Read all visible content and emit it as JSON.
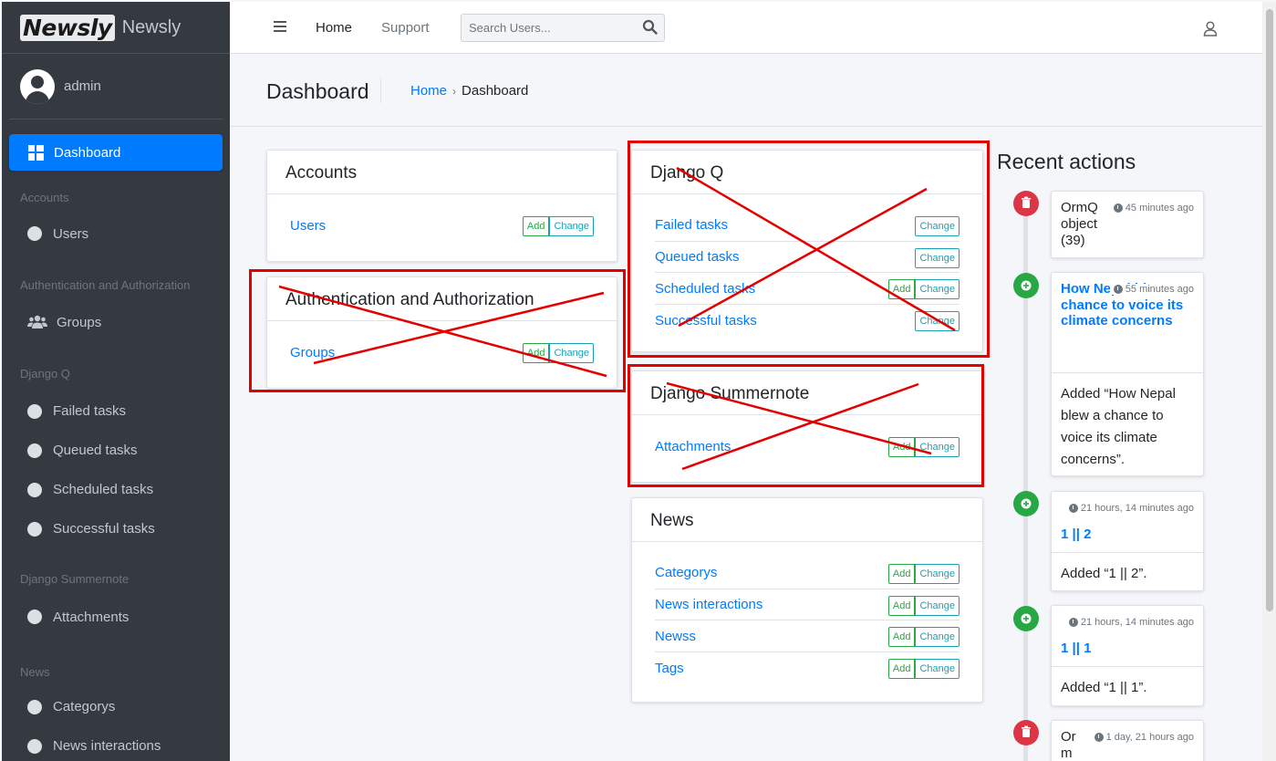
{
  "brand": {
    "logo": "Newsly",
    "name": "Newsly"
  },
  "user": {
    "name": "admin"
  },
  "sidebar": {
    "dashboard": "Dashboard",
    "sections": [
      {
        "header": "Accounts",
        "items": [
          "Users"
        ]
      },
      {
        "header": "Authentication and Authorization",
        "items": [
          "Groups"
        ]
      },
      {
        "header": "Django Q",
        "items": [
          "Failed tasks",
          "Queued tasks",
          "Scheduled tasks",
          "Successful tasks"
        ]
      },
      {
        "header": "Django Summernote",
        "items": [
          "Attachments"
        ]
      },
      {
        "header": "News",
        "items": [
          "Categorys",
          "News interactions"
        ]
      }
    ]
  },
  "topbar": {
    "home": "Home",
    "support": "Support",
    "search_placeholder": "Search Users..."
  },
  "content": {
    "title": "Dashboard",
    "breadcrumb": {
      "home": "Home",
      "separator": "›",
      "current": "Dashboard"
    }
  },
  "buttons": {
    "add": "Add",
    "change": "Change"
  },
  "apps": [
    {
      "name": "Accounts",
      "models": [
        {
          "name": "Users",
          "add": true
        }
      ]
    },
    {
      "name": "Authentication and Authorization",
      "models": [
        {
          "name": "Groups",
          "add": true
        }
      ]
    },
    {
      "name": "Django Q",
      "models": [
        {
          "name": "Failed tasks",
          "add": false
        },
        {
          "name": "Queued tasks",
          "add": false
        },
        {
          "name": "Scheduled tasks",
          "add": true
        },
        {
          "name": "Successful tasks",
          "add": false
        }
      ]
    },
    {
      "name": "Django Summernote",
      "models": [
        {
          "name": "Attachments",
          "add": true
        }
      ]
    },
    {
      "name": "News",
      "models": [
        {
          "name": "Categorys",
          "add": true
        },
        {
          "name": "News interactions",
          "add": true
        },
        {
          "name": "Newss",
          "add": true
        },
        {
          "name": "Tags",
          "add": true
        }
      ]
    }
  ],
  "recent": {
    "title": "Recent actions",
    "items": [
      {
        "type": "delete",
        "object": "OrmQ object (39)",
        "time": "45 minutes ago",
        "message": ""
      },
      {
        "type": "add",
        "object": "How Nepal blew a chance to voice its climate concerns",
        "time": "55 minutes ago",
        "message": "Added “How Nepal blew a chance to voice its climate concerns”."
      },
      {
        "type": "add",
        "object": "1 || 2",
        "time": "21 hours, 14 minutes ago",
        "message": "Added “1 || 2”."
      },
      {
        "type": "add",
        "object": "1 || 1",
        "time": "21 hours, 14 minutes ago",
        "message": "Added “1 || 1”."
      },
      {
        "type": "delete",
        "object": "OrmQ",
        "time": "1 day, 21 hours ago",
        "message": ""
      }
    ]
  },
  "colors": {
    "sidebar": "#343a40",
    "primary": "#007bff",
    "add": "#28a745",
    "change": "#17a2b8",
    "delete": "#dc3545",
    "annotation": "#e50000"
  }
}
